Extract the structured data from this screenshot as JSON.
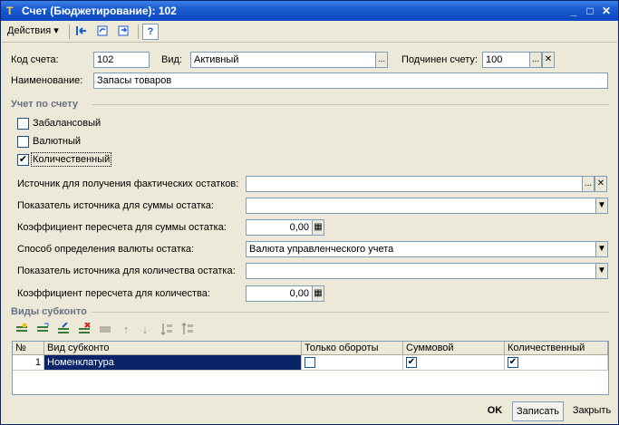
{
  "window": {
    "title": "Счет (Бюджетирование): 102",
    "icon": "T"
  },
  "toolbar": {
    "actions_label": "Действия",
    "icons": [
      "navigate-back-icon",
      "refresh-icon",
      "go-to-icon",
      "help-icon"
    ],
    "help_glyph": "?"
  },
  "form": {
    "code_label": "Код счета:",
    "code_value": "102",
    "type_label": "Вид:",
    "type_value": "Активный",
    "parent_label": "Подчинен счету:",
    "parent_value": "100",
    "name_label": "Наименование:",
    "name_value": "Запасы товаров"
  },
  "accounting": {
    "section_title": "Учет по счету",
    "off_balance_label": "Забалансовый",
    "off_balance_checked": false,
    "currency_label": "Валютный",
    "currency_checked": false,
    "quantity_label": "Количественный",
    "quantity_checked": true,
    "source_actual_label": "Источник для получения фактических остатков:",
    "source_actual_value": "",
    "sum_source_label": "Показатель источника для суммы остатка:",
    "sum_source_value": "",
    "sum_coef_label": "Коэффициент пересчета для суммы остатка:",
    "sum_coef_value": "0,00",
    "currency_method_label": "Способ определения валюты остатка:",
    "currency_method_value": "Валюта управленческого учета",
    "qty_source_label": "Показатель источника для количества остатка:",
    "qty_source_value": "",
    "qty_coef_label": "Коэффициент пересчета для количества:",
    "qty_coef_value": "0,00"
  },
  "subconto": {
    "section_title": "Виды субконто",
    "toolbar_icons": [
      "add-row-icon",
      "copy-row-icon",
      "edit-row-icon",
      "delete-row-icon",
      "end-edit-icon",
      "move-up-icon",
      "move-down-icon",
      "sort-asc-icon",
      "sort-desc-icon"
    ],
    "up_glyph": "↑",
    "down_glyph": "↓",
    "columns": [
      "№",
      "Вид субконто",
      "Только обороты",
      "Суммовой",
      "Количественный"
    ],
    "rows": [
      {
        "num": "1",
        "kind": "Номенклатура",
        "turnover_only": false,
        "sum": true,
        "quantity": true
      }
    ]
  },
  "buttons": {
    "ok": "OK",
    "save": "Записать",
    "close": "Закрыть"
  },
  "glyphs": {
    "ellipsis": "...",
    "clear": "✕",
    "dropdown": "▼",
    "calc": "▦",
    "check": "✔"
  },
  "colors": {
    "title_bar": "#0b47c0",
    "selection": "#0a246a",
    "section_text": "#6b6f85",
    "window_bg": "#ece9d8"
  }
}
